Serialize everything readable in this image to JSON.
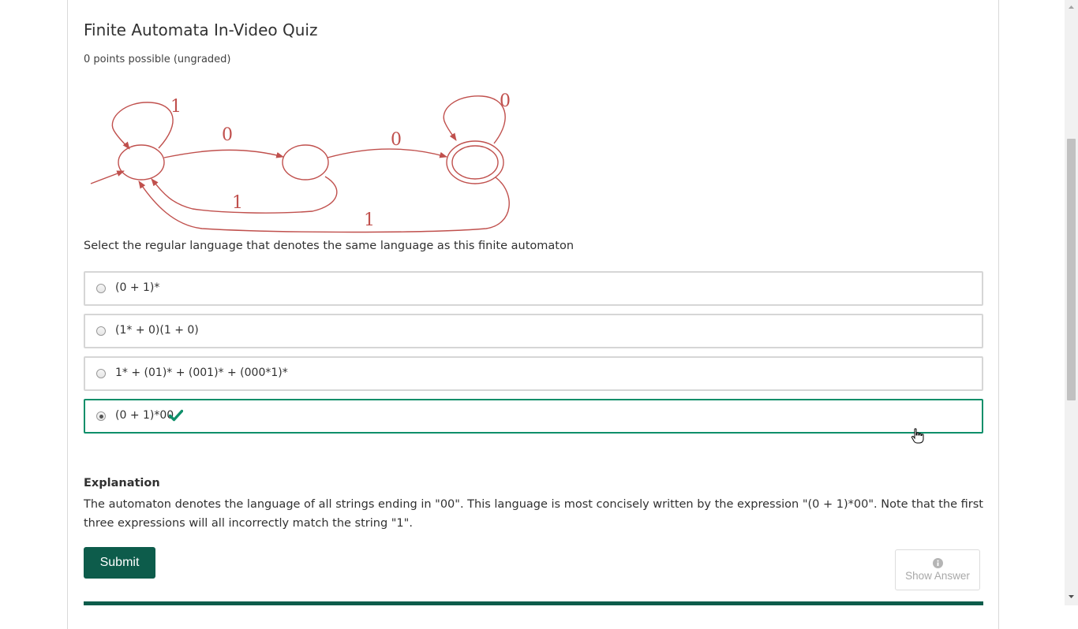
{
  "quiz": {
    "title": "Finite Automata In-Video Quiz",
    "points": "0 points possible (ungraded)",
    "question": "Select the regular language that denotes the same language as this finite automaton"
  },
  "automaton": {
    "edge_labels": {
      "self_loop_start": "1",
      "start_to_middle": "0",
      "middle_to_accept": "0",
      "self_loop_accept": "0",
      "middle_to_start": "1",
      "accept_to_start": "1"
    },
    "colors": {
      "stroke": "#c0504d"
    }
  },
  "choices": [
    {
      "label": "(0 + 1)*",
      "selected": false,
      "correct": false
    },
    {
      "label": "(1* + 0)(1 + 0)",
      "selected": false,
      "correct": false
    },
    {
      "label": "1* + (01)* + (001)* + (000*1)*",
      "selected": false,
      "correct": false
    },
    {
      "label": "(0 + 1)*00",
      "selected": true,
      "correct": true
    }
  ],
  "explanation": {
    "heading": "Explanation",
    "text": "The automaton denotes the language of all strings ending in \"00\". This language is most concisely written by the expression \"(0 + 1)*00\". Note that the first three expressions will all incorrectly match the string \"1\"."
  },
  "actions": {
    "submit_label": "Submit",
    "show_answer_label": "Show Answer",
    "show_answer_icon": "info-icon"
  },
  "colors": {
    "accent": "#0d5c4b",
    "correct_border": "#0f8f6a",
    "check": "#0f8f6a"
  }
}
